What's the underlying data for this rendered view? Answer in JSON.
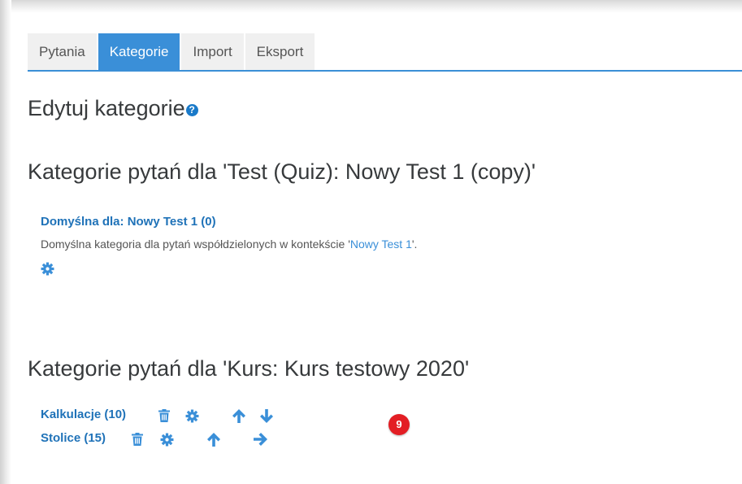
{
  "tabs": [
    {
      "label": "Pytania",
      "active": false
    },
    {
      "label": "Kategorie",
      "active": true
    },
    {
      "label": "Import",
      "active": false
    },
    {
      "label": "Eksport",
      "active": false
    }
  ],
  "page_title": "Edytuj kategorie",
  "help_icon": "question-circle-icon",
  "sections": [
    {
      "title": "Kategorie pytań dla 'Test (Quiz): Nowy Test 1 (copy)'",
      "categories": [
        {
          "label": "Domyślna dla: Nowy Test 1 (0)",
          "description_prefix": "Domyślna kategoria dla pytań współdzielonych w kontekście '",
          "description_link": "Nowy Test 1",
          "description_suffix": "'.",
          "icons": [
            "gear-icon"
          ]
        }
      ]
    },
    {
      "title": "Kategorie pytań dla 'Kurs: Kurs testowy 2020'",
      "categories": [
        {
          "label": "Kalkulacje (10)",
          "icons": [
            "trash-icon",
            "gear-icon",
            "arrow-up-icon",
            "arrow-down-icon"
          ]
        },
        {
          "label": "Stolice (15)",
          "icons": [
            "trash-icon",
            "gear-icon",
            "arrow-up-icon",
            "arrow-right-icon"
          ]
        }
      ]
    }
  ],
  "annotation_badge": "9",
  "colors": {
    "accent": "#3a8fd8",
    "link": "#1f72b8",
    "badge": "#e31e24"
  }
}
